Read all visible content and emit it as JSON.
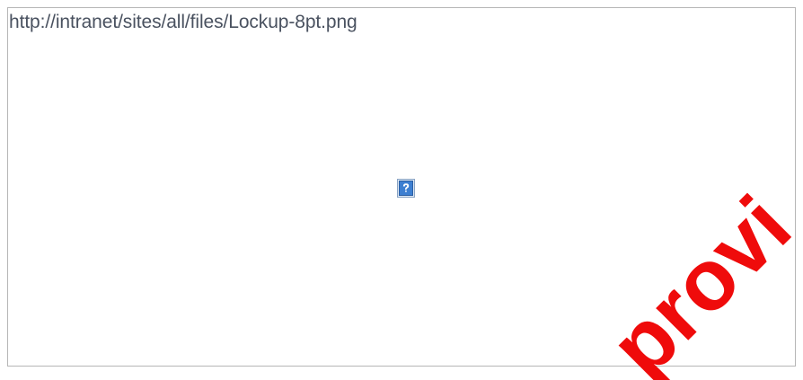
{
  "image_placeholder": {
    "alt_text": "http://intranet/sites/all/files/Lockup-8pt.png",
    "icon": "broken-image-question-icon"
  },
  "watermark": {
    "text": "provi",
    "color": "#ef0b0b"
  }
}
